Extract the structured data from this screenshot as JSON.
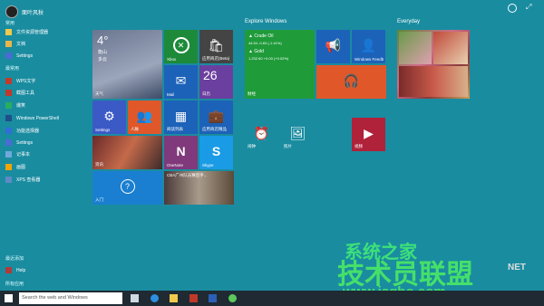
{
  "user": {
    "name": "面叶风秋"
  },
  "left": {
    "section_top": "常用",
    "top_apps": [
      "文件资源管理器",
      "文档",
      "Settings"
    ],
    "section_most": "最常用",
    "most_apps": [
      "WPS文字",
      "截图工具",
      "爆笑",
      "Windows PowerShell",
      "功能选择器",
      "Settings",
      "记事本",
      "画图",
      "XPS 查看器"
    ],
    "section_recent": "最近添加",
    "recent_apps": [
      "Help"
    ],
    "all_apps": "所有应用"
  },
  "tiles": {
    "weather": {
      "temp": "4°",
      "city": "衡山",
      "cond": "多云",
      "label": "天气"
    },
    "xbox": "Xbox",
    "store": "应用商店(Beta)",
    "mail": "Mail",
    "calendar": {
      "day": "26",
      "label": "日历"
    },
    "settings": "Settings",
    "people": "人脉",
    "reading": "阅读列表",
    "photos2": "应用商店精品",
    "news": "资讯",
    "onenote": "OneNote",
    "skype": "Skype",
    "help": "入门",
    "photo_tile": "CBA广州队员赛后手..."
  },
  "explore": {
    "title": "Explore Windows",
    "money": {
      "l1": "▲ Crude Oil",
      "l2": "44.54  -0.63 (-1.41%)",
      "l3": "▲ Gold",
      "l4": "1,232.60  +0.00 (+0.02%)",
      "label": "财经"
    },
    "feedback": "Windows Feedb",
    "alarm": "闹钟",
    "photos": "照片",
    "video": "视频"
  },
  "everyday": {
    "title": "Everyday"
  },
  "taskbar": {
    "search_placeholder": "Search the web and Windows"
  },
  "watermark": {
    "line1": "技术员联盟",
    "line2": "www.jsgho.com",
    "line3": "系统之家",
    "line4": "NET"
  }
}
